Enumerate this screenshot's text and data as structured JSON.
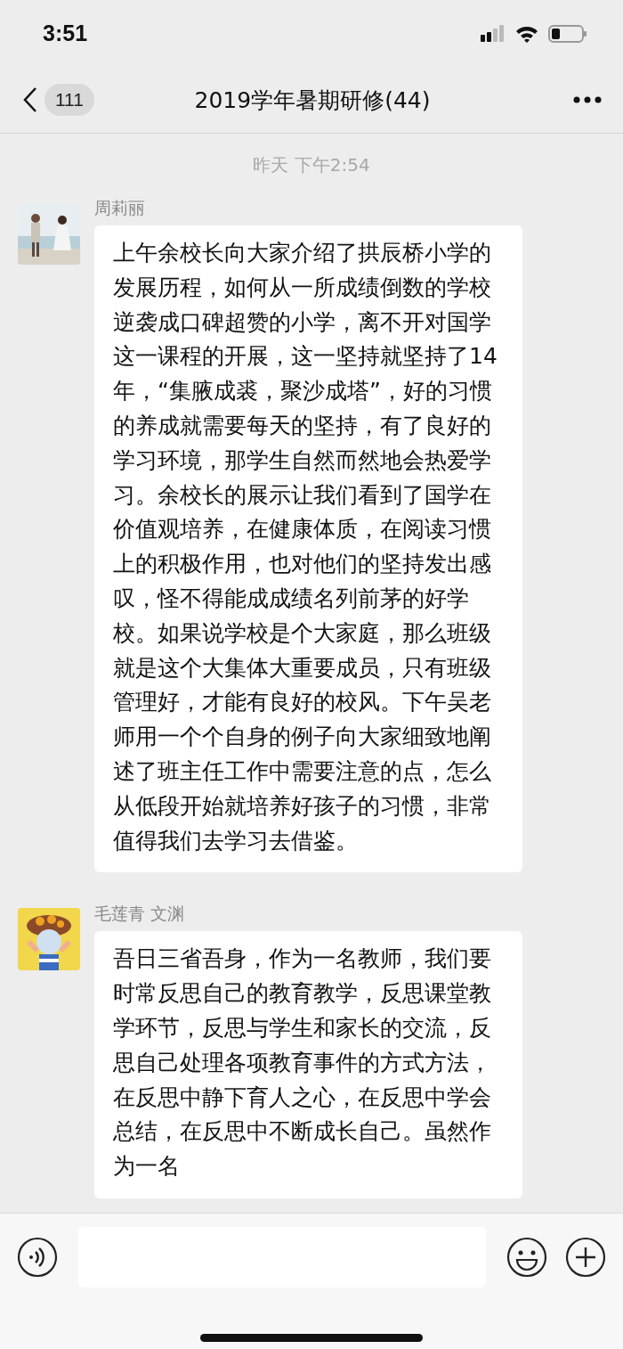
{
  "status_bar": {
    "time": "3:51"
  },
  "nav": {
    "badge": "111",
    "title": "2019学年暑期研修(44)"
  },
  "messages": [
    {
      "kind": "time",
      "text": "昨天 下午2:54"
    },
    {
      "kind": "text",
      "sender": "周莉丽",
      "text": "上午余校长向大家介绍了拱辰桥小学的发展历程，如何从一所成绩倒数的学校逆袭成口碑超赞的小学，离不开对国学这一课程的开展，这一坚持就坚持了14年，“集腋成裘，聚沙成塔”，好的习惯的养成就需要每天的坚持，有了良好的学习环境，那学生自然而然地会热爱学习。余校长的展示让我们看到了国学在价值观培养，在健康体质，在阅读习惯上的积极作用，也对他们的坚持发出感叹，怪不得能成成绩名列前茅的好学校。如果说学校是个大家庭，那么班级就是这个大集体大重要成员，只有班级管理好，才能有良好的校风。下午吴老师用一个个自身的例子向大家细致地阐述了班主任工作中需要注意的点，怎么从低段开始就培养好孩子的习惯，非常值得我们去学习去借鉴。"
    },
    {
      "kind": "text",
      "sender": "毛莲青 文渊",
      "text": "吾日三省吾身，作为一名教师，我们要时常反思自己的教育教学，反思课堂教学环节，反思与学生和家长的交流，反思自己处理各项教育事件的方式方法，在反思中静下育人之心，在反思中学会总结，在反思中不断成长自己。虽然作为一名"
    }
  ]
}
